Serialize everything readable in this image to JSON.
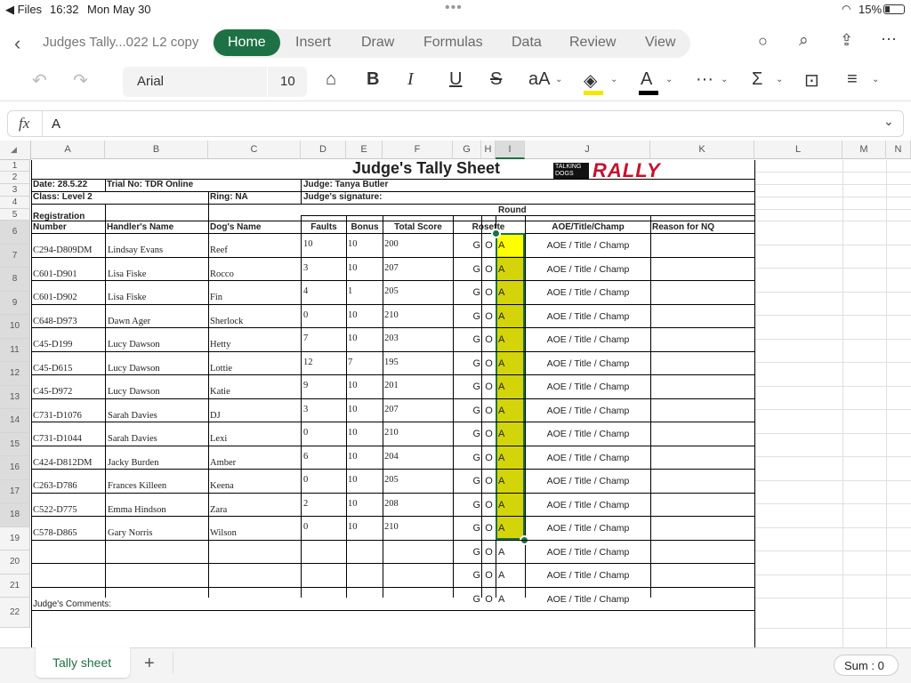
{
  "status": {
    "back_app": "◀ Files",
    "time": "16:32",
    "date": "Mon May 30",
    "battery": "15%"
  },
  "menu": {
    "file_title": "Judges Tally...022 L2 copy",
    "tabs": [
      "Home",
      "Insert",
      "Draw",
      "Formulas",
      "Data",
      "Review",
      "View"
    ]
  },
  "toolbar": {
    "font_name": "Arial",
    "font_size": "10"
  },
  "formula_bar": {
    "fx": "fx",
    "value": "A"
  },
  "columns": [
    "A",
    "B",
    "C",
    "D",
    "E",
    "F",
    "G",
    "H",
    "I",
    "J",
    "K",
    "L",
    "M",
    "N"
  ],
  "rows": [
    "1",
    "2",
    "3",
    "4",
    "5",
    "6",
    "7",
    "8",
    "9",
    "10",
    "11",
    "12",
    "13",
    "14",
    "15",
    "16",
    "17",
    "18",
    "19",
    "20",
    "21",
    "22"
  ],
  "sheet": {
    "title": "Judge's Tally Sheet",
    "logo_small": "TALKING DOGS",
    "logo_big": "RALLY",
    "date": "Date: 28.5.22",
    "trial_no": "Trial No: TDR Online",
    "judge": "Judge: Tanya Butler",
    "class": "Class: Level 2",
    "ring": "Ring: NA",
    "signature": "Judge's signature:",
    "round": "Round",
    "h_reg": "Registration Number",
    "h_handler": "Handler's Name",
    "h_dog": "Dog's Name",
    "h_faults": "Faults",
    "h_bonus": "Bonus",
    "h_total": "Total Score",
    "h_rosette": "Rosette",
    "h_aoe": "AOE/Title/Champ",
    "h_nq": "Reason for NQ",
    "comments": "Judge's Comments:",
    "rows": [
      {
        "reg": "C294-D809DM",
        "handler": "Lindsay Evans",
        "dog": "Reef",
        "faults": "10",
        "bonus": "10",
        "total": "200",
        "g": "G",
        "o": "O",
        "a": "A",
        "aoe": "AOE / Title / Champ"
      },
      {
        "reg": "C601-D901",
        "handler": "Lisa Fiske",
        "dog": "Rocco",
        "faults": "3",
        "bonus": "10",
        "total": "207",
        "g": "G",
        "o": "O",
        "a": "A",
        "aoe": "AOE / Title / Champ"
      },
      {
        "reg": "C601-D902",
        "handler": "Lisa Fiske",
        "dog": "Fin",
        "faults": "4",
        "bonus": "1",
        "total": "205",
        "g": "G",
        "o": "O",
        "a": "A",
        "aoe": "AOE / Title / Champ"
      },
      {
        "reg": "C648-D973",
        "handler": "Dawn Ager",
        "dog": "Sherlock",
        "faults": "0",
        "bonus": "10",
        "total": "210",
        "g": "G",
        "o": "O",
        "a": "A",
        "aoe": "AOE / Title / Champ"
      },
      {
        "reg": "C45-D199",
        "handler": "Lucy Dawson",
        "dog": "Hetty",
        "faults": "7",
        "bonus": "10",
        "total": "203",
        "g": "G",
        "o": "O",
        "a": "A",
        "aoe": "AOE / Title / Champ"
      },
      {
        "reg": "C45-D615",
        "handler": "Lucy Dawson",
        "dog": "Lottie",
        "faults": "12",
        "bonus": "7",
        "total": "195",
        "g": "G",
        "o": "O",
        "a": "A",
        "aoe": "AOE / Title / Champ"
      },
      {
        "reg": "C45-D972",
        "handler": "Lucy Dawson",
        "dog": "Katie",
        "faults": "9",
        "bonus": "10",
        "total": "201",
        "g": "G",
        "o": "O",
        "a": "A",
        "aoe": "AOE / Title / Champ"
      },
      {
        "reg": "C731-D1076",
        "handler": "Sarah Davies",
        "dog": "DJ",
        "faults": "3",
        "bonus": "10",
        "total": "207",
        "g": "G",
        "o": "O",
        "a": "A",
        "aoe": "AOE / Title / Champ"
      },
      {
        "reg": "C731-D1044",
        "handler": "Sarah Davies",
        "dog": "Lexi",
        "faults": "0",
        "bonus": "10",
        "total": "210",
        "g": "G",
        "o": "O",
        "a": "A",
        "aoe": "AOE / Title / Champ"
      },
      {
        "reg": "C424-D812DM",
        "handler": "Jacky Burden",
        "dog": "Amber",
        "faults": "6",
        "bonus": "10",
        "total": "204",
        "g": "G",
        "o": "O",
        "a": "A",
        "aoe": "AOE / Title / Champ"
      },
      {
        "reg": "C263-D786",
        "handler": "Frances Killeen",
        "dog": "Keena",
        "faults": "0",
        "bonus": "10",
        "total": "205",
        "g": "G",
        "o": "O",
        "a": "A",
        "aoe": "AOE / Title / Champ"
      },
      {
        "reg": "C522-D775",
        "handler": "Emma Hindson",
        "dog": "Zara",
        "faults": "2",
        "bonus": "10",
        "total": "208",
        "g": "G",
        "o": "O",
        "a": "A",
        "aoe": "AOE / Title / Champ"
      },
      {
        "reg": "C578-D865",
        "handler": "Gary Norris",
        "dog": "Wilson",
        "faults": "0",
        "bonus": "10",
        "total": "210",
        "g": "G",
        "o": "O",
        "a": "A",
        "aoe": "AOE / Title / Champ"
      },
      {
        "reg": "",
        "handler": "",
        "dog": "",
        "faults": "",
        "bonus": "",
        "total": "",
        "g": "G",
        "o": "O",
        "a": "A",
        "aoe": "AOE / Title / Champ"
      },
      {
        "reg": "",
        "handler": "",
        "dog": "",
        "faults": "",
        "bonus": "",
        "total": "",
        "g": "G",
        "o": "O",
        "a": "A",
        "aoe": "AOE / Title / Champ"
      },
      {
        "reg": "",
        "handler": "",
        "dog": "",
        "faults": "",
        "bonus": "",
        "total": "",
        "g": "G",
        "o": "O",
        "a": "A",
        "aoe": "AOE / Title / Champ"
      }
    ]
  },
  "bottom": {
    "sheet_tab": "Tally sheet",
    "add": "+",
    "sum": "Sum : 0"
  },
  "colors": {
    "accent": "#1e7145",
    "selection": "#d4d40a",
    "active_cell": "#ffff00"
  }
}
